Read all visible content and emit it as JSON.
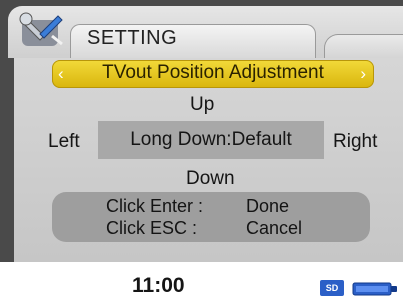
{
  "header": {
    "tab_label": "SETTING"
  },
  "dialog": {
    "title": "TVout Position Adjustment",
    "left_arrow": "‹",
    "right_arrow": "›",
    "up_label": "Up",
    "down_label": "Down",
    "left_label": "Left",
    "right_label": "Right",
    "center_value": "Long Down:Default",
    "hints": [
      {
        "key": "Click Enter :",
        "action": "Done"
      },
      {
        "key": "Click ESC  :",
        "action": "Cancel"
      }
    ]
  },
  "status": {
    "time": "11:00",
    "sd_label": "SD"
  },
  "colors": {
    "title_accent": "#e7c620",
    "panel": "#cccccc",
    "sd_blue": "#2b5fc7"
  },
  "icons": [
    "tools-icon",
    "left-arrow-icon",
    "right-arrow-icon",
    "sd-card-icon",
    "battery-icon"
  ]
}
